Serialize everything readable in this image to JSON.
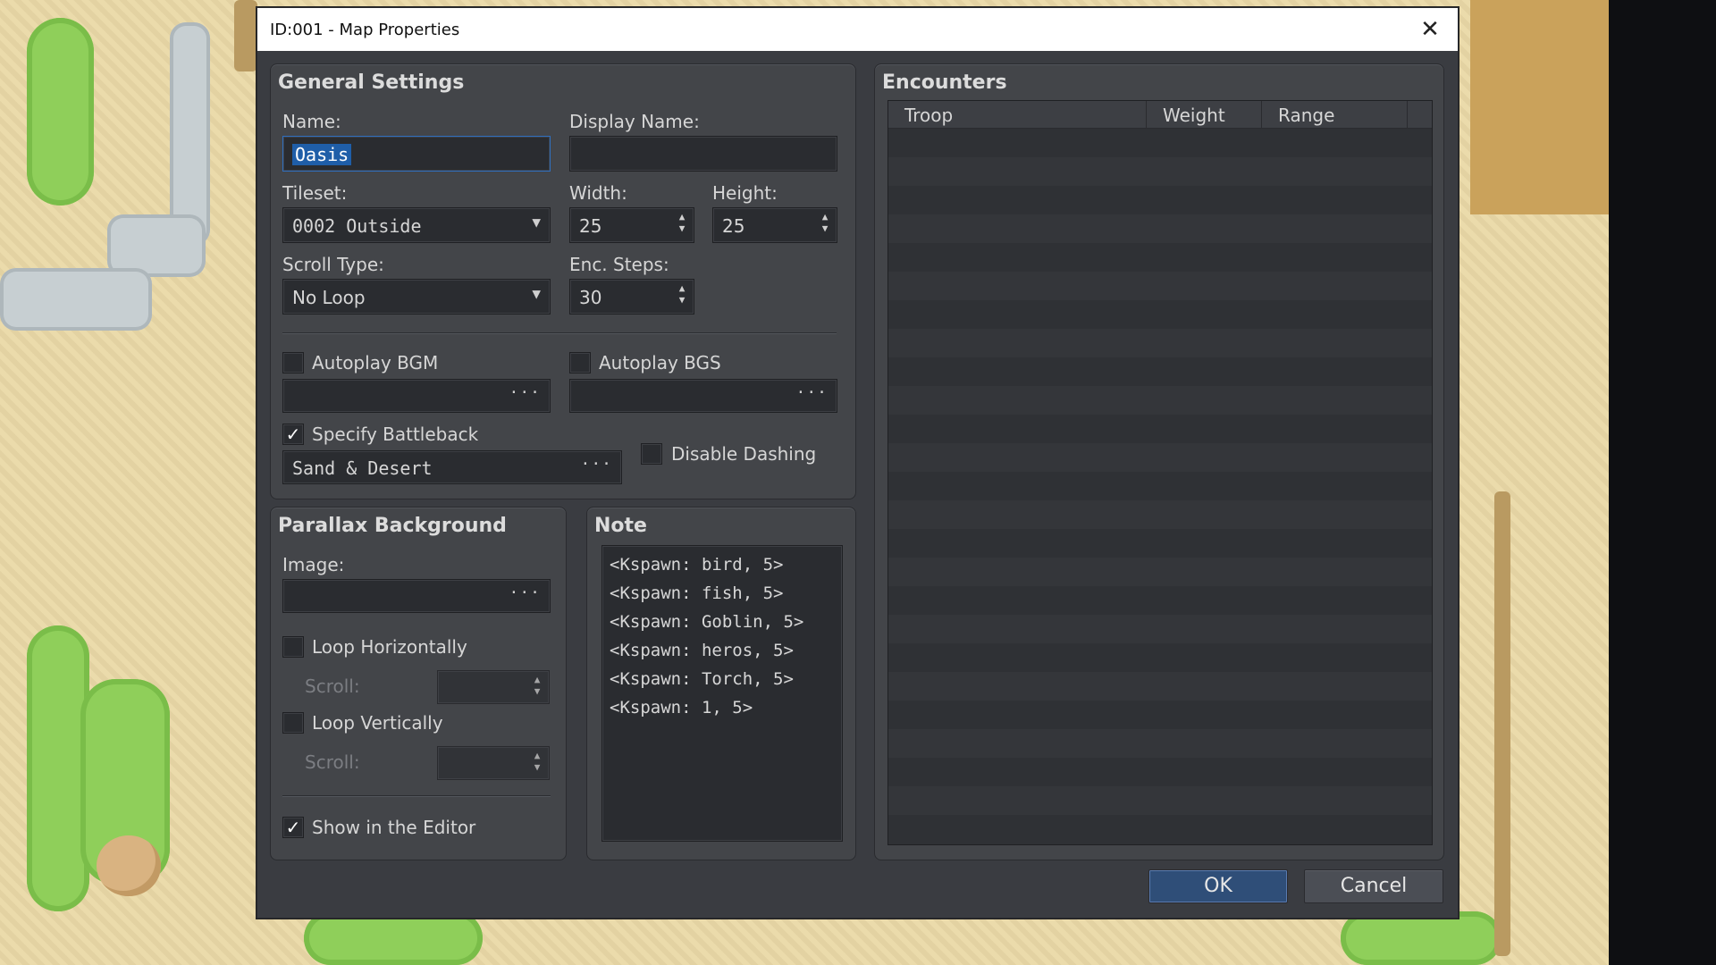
{
  "window": {
    "title": "ID:001 - Map Properties",
    "close_icon": "close-icon"
  },
  "general": {
    "title": "General Settings",
    "name_label": "Name:",
    "name_value": "Oasis",
    "display_name_label": "Display Name:",
    "display_name_value": "",
    "tileset_label": "Tileset:",
    "tileset_value": "0002 Outside",
    "width_label": "Width:",
    "width_value": "25",
    "height_label": "Height:",
    "height_value": "25",
    "scroll_type_label": "Scroll Type:",
    "scroll_type_value": "No Loop",
    "enc_steps_label": "Enc. Steps:",
    "enc_steps_value": "30",
    "autoplay_bgm_label": "Autoplay BGM",
    "autoplay_bgm_checked": false,
    "autoplay_bgs_label": "Autoplay BGS",
    "autoplay_bgs_checked": false,
    "specify_battleback_label": "Specify Battleback",
    "specify_battleback_checked": true,
    "battleback_value": "Sand & Desert",
    "disable_dashing_label": "Disable Dashing",
    "disable_dashing_checked": false,
    "ellipsis": "···"
  },
  "parallax": {
    "title": "Parallax Background",
    "image_label": "Image:",
    "loop_h_label": "Loop Horizontally",
    "loop_v_label": "Loop Vertically",
    "scroll_label": "Scroll:",
    "show_editor_label": "Show in the Editor",
    "show_editor_checked": true
  },
  "note": {
    "title": "Note",
    "lines": [
      "<Kspawn: bird, 5>",
      "<Kspawn: fish, 5>",
      "<Kspawn: Goblin, 5>",
      "<Kspawn: heros, 5>",
      "<Kspawn: Torch, 5>",
      "<Kspawn: 1, 5>"
    ]
  },
  "encounters": {
    "title": "Encounters",
    "columns": [
      "Troop",
      "Weight",
      "Range"
    ]
  },
  "buttons": {
    "ok": "OK",
    "cancel": "Cancel"
  },
  "icons": {
    "dropdown": "chevron-down-icon",
    "spinner": "spinner-icon",
    "check": "check-icon"
  }
}
